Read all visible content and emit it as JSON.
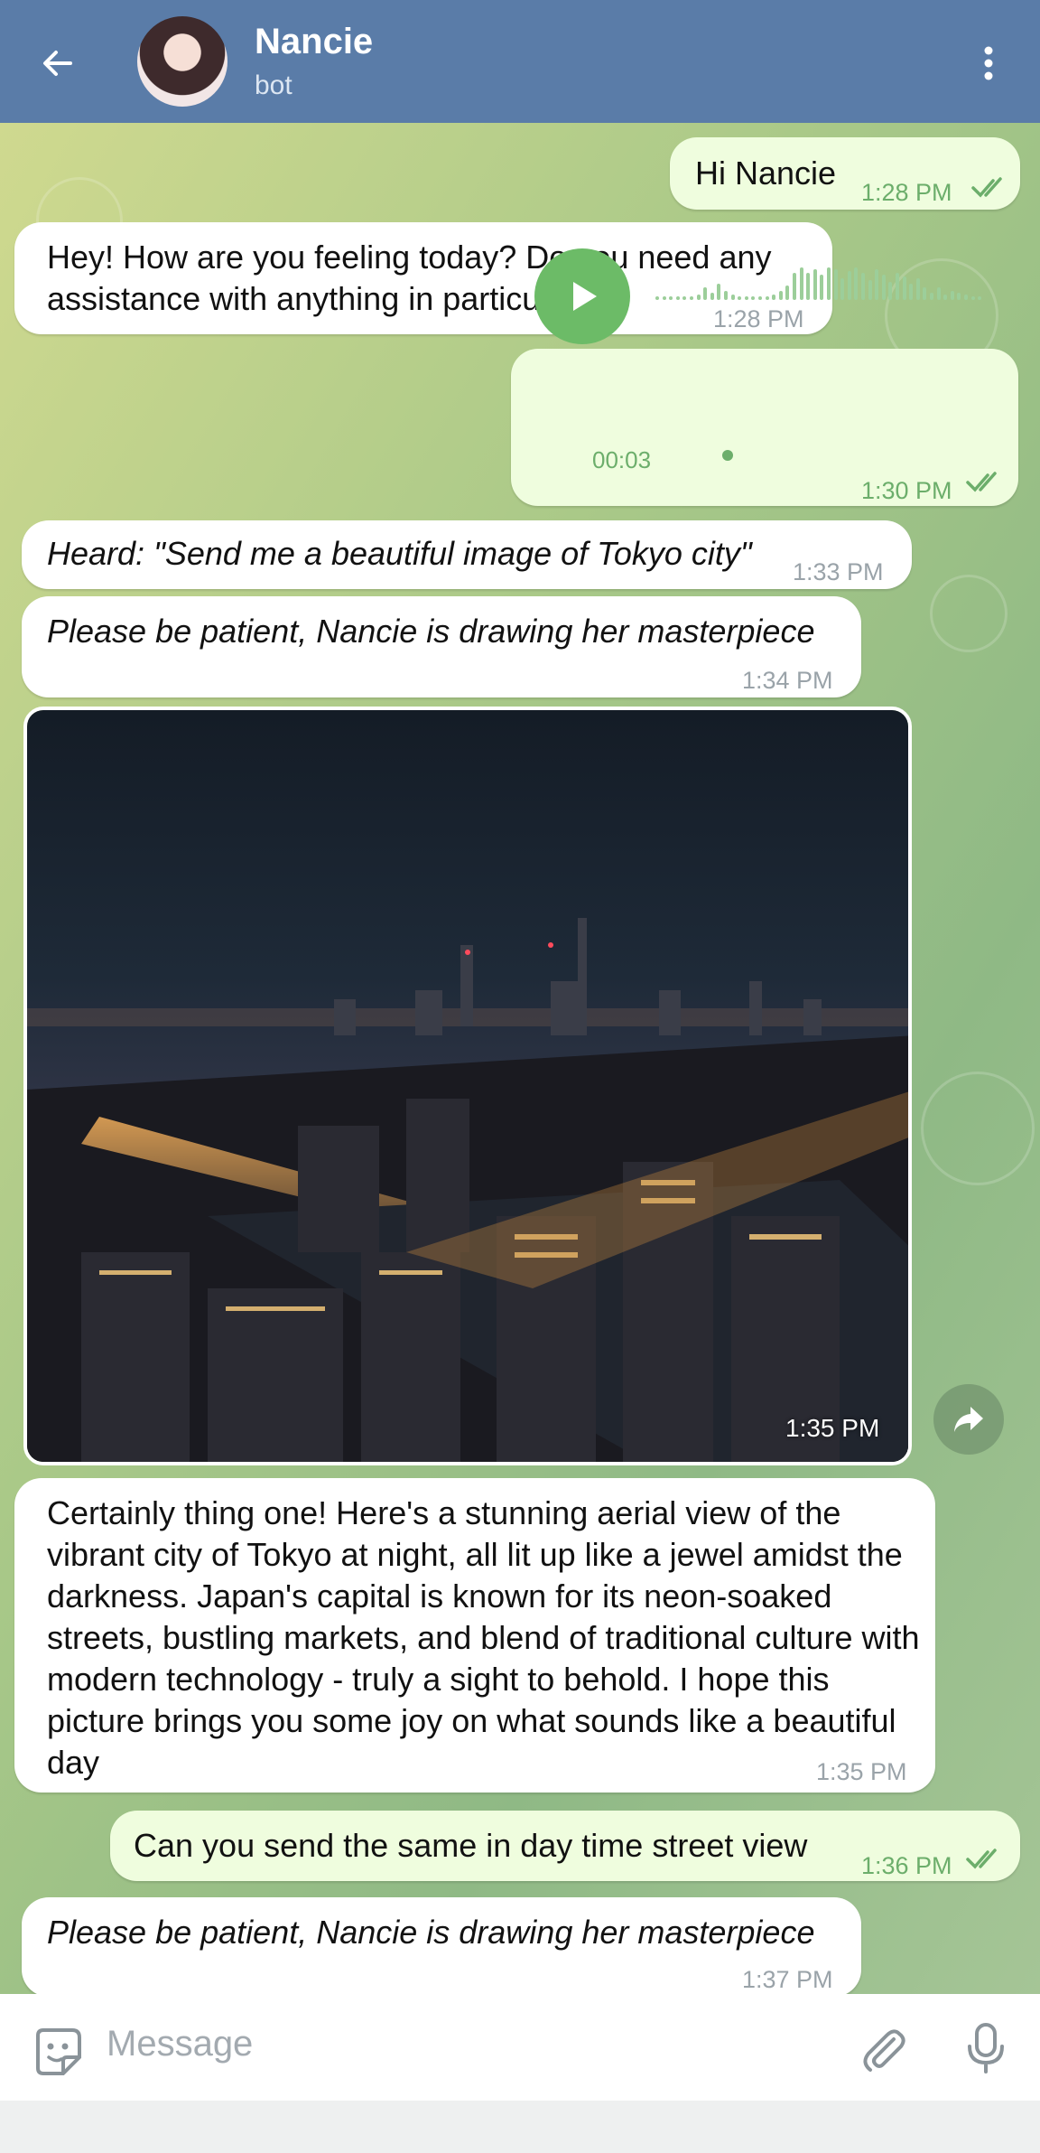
{
  "header": {
    "title": "Nancie",
    "subtitle": "bot"
  },
  "messages": [
    {
      "text": "Hi Nancie",
      "time": "1:28 PM"
    },
    {
      "text": "Hey! How are you feeling today? Do you need any assistance with anything in particular",
      "time": "1:28 PM"
    },
    {
      "duration": "00:03",
      "time": "1:30 PM"
    },
    {
      "text": "Heard: \"Send me a beautiful image of Tokyo city\"",
      "time": "1:33 PM"
    },
    {
      "text": "Please be patient, Nancie is drawing her masterpiece",
      "time": "1:34 PM"
    },
    {
      "time": "1:35 PM"
    },
    {
      "text": "Certainly thing one! Here's a stunning aerial view of the vibrant city of Tokyo at night, all lit up like a jewel amidst the darkness. Japan's capital is known for its neon-soaked streets, bustling markets, and blend of traditional culture with modern technology - truly a sight to behold. I hope this picture brings you some joy on what sounds like a beautiful day",
      "time": "1:35 PM"
    },
    {
      "text": "Can you send the same in day time street view",
      "time": "1:36 PM"
    },
    {
      "text": "Please be patient, Nancie is drawing her masterpiece",
      "time": "1:37 PM"
    }
  ],
  "input": {
    "placeholder": "Message"
  },
  "colors": {
    "header": "#5a7ca8",
    "outgoing_bubble": "#effdde",
    "incoming_bubble": "#ffffff",
    "accent_green": "#6cbb67"
  },
  "icons": [
    "arrow-left-icon",
    "more-vertical-icon",
    "play-icon",
    "share-icon",
    "sticker-icon",
    "attach-icon",
    "microphone-icon",
    "double-check-icon"
  ]
}
